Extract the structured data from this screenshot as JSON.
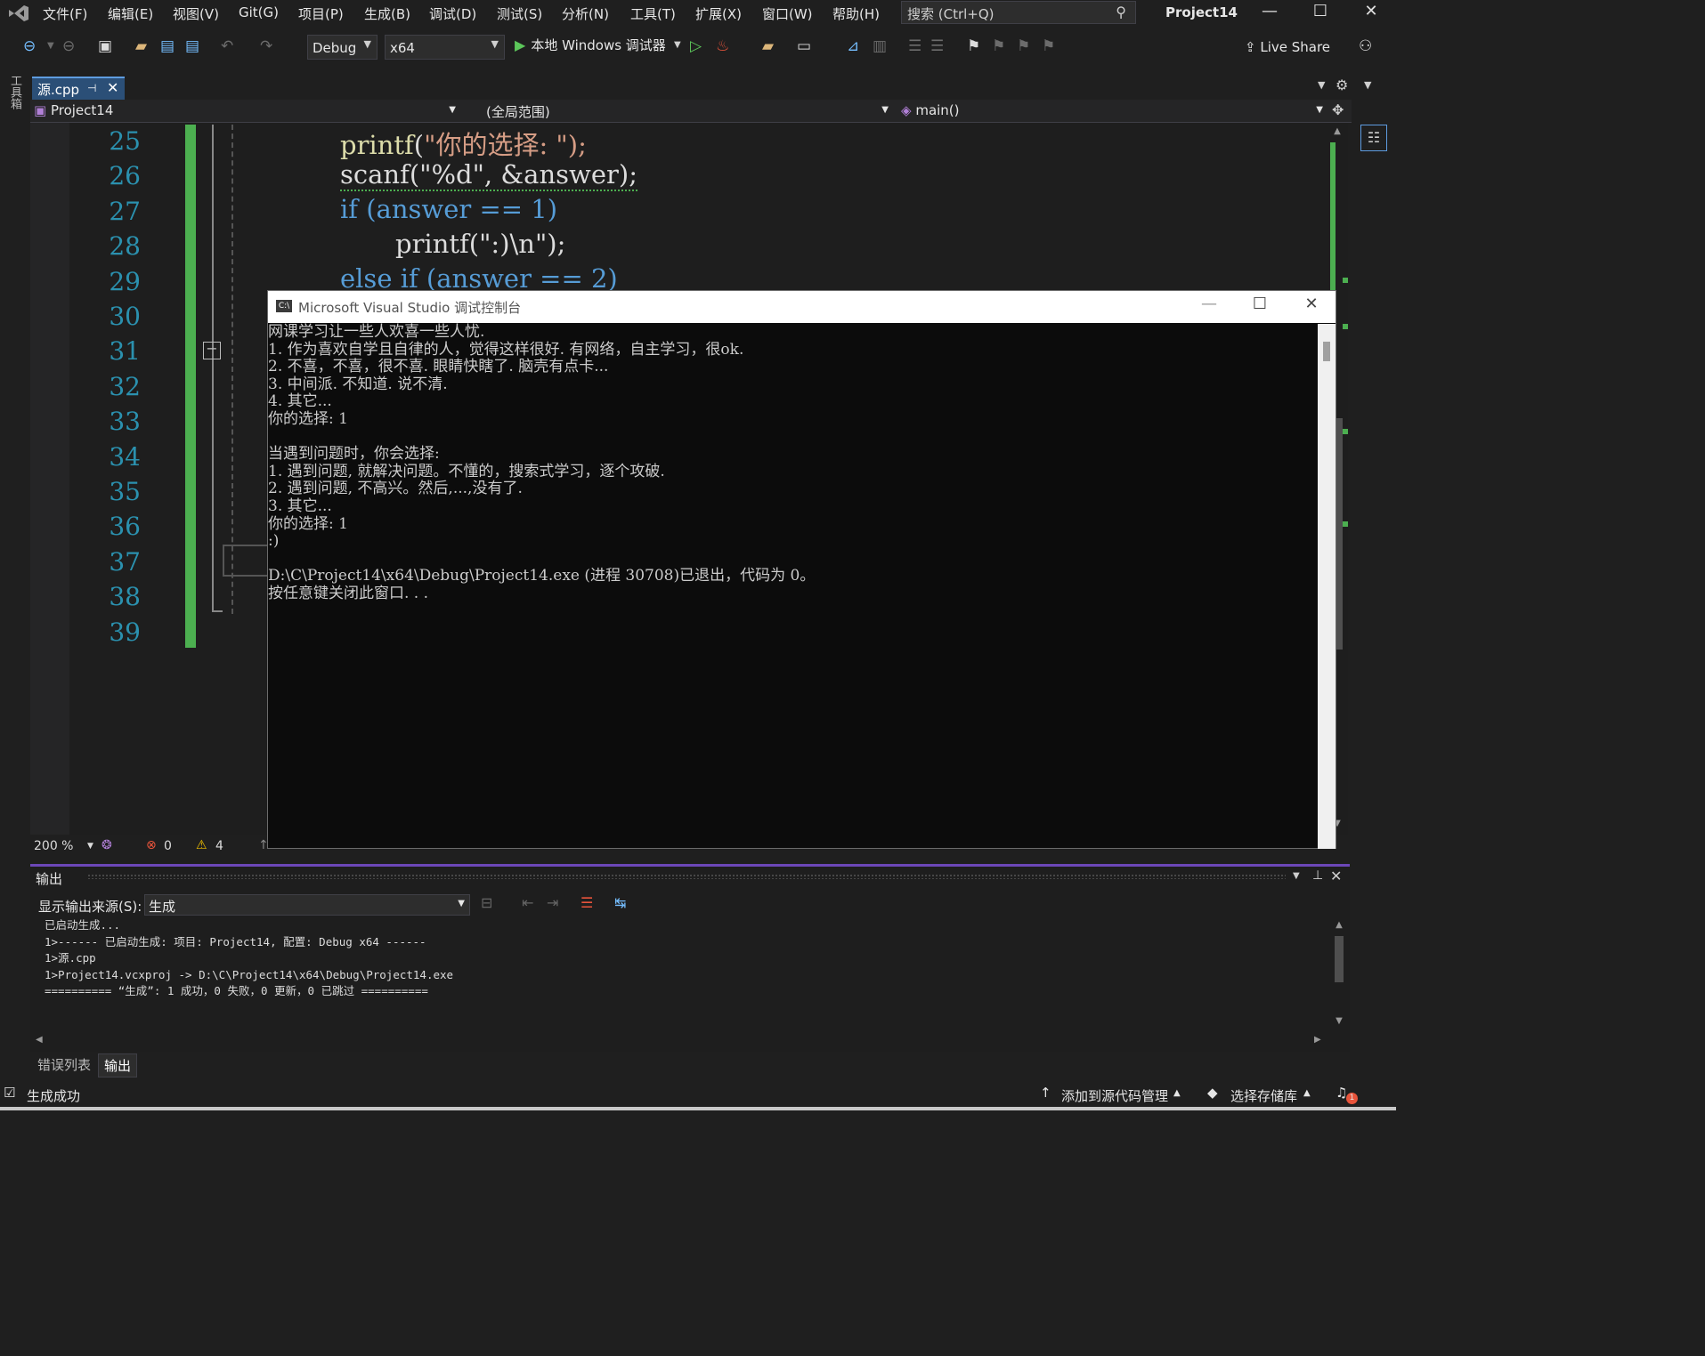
{
  "menu": {
    "items": [
      "文件(F)",
      "编辑(E)",
      "视图(V)",
      "Git(G)",
      "项目(P)",
      "生成(B)",
      "调试(D)",
      "测试(S)",
      "分析(N)",
      "工具(T)",
      "扩展(X)",
      "窗口(W)",
      "帮助(H)"
    ],
    "search_placeholder": "搜索 (Ctrl+Q)",
    "project_title": "Project14"
  },
  "toolbar": {
    "config": "Debug",
    "platform": "x64",
    "run_label": "本地 Windows 调试器",
    "live_share": "Live Share"
  },
  "sidebar": {
    "toolbox_label": "工具箱"
  },
  "tabs": {
    "active": "源.cpp"
  },
  "navbar": {
    "project": "Project14",
    "scope": "(全局范围)",
    "member": "main()"
  },
  "editor": {
    "line_numbers": [
      "25",
      "26",
      "27",
      "28",
      "29",
      "30",
      "31",
      "32",
      "33",
      "34",
      "35",
      "36",
      "37",
      "38",
      "39"
    ],
    "visible_code": [
      "printf(\"你的选择: \");",
      "scanf(\"%d\", &answer);",
      "if (answer == 1)",
      "printf(\":)\\n\");",
      "else if (answer == 2)"
    ],
    "zoom": "200 %",
    "errors": "0",
    "warnings": "4"
  },
  "console": {
    "title": "Microsoft Visual Studio 调试控制台",
    "lines": [
      "网课学习让一些人欢喜一些人忧.",
      "1. 作为喜欢自学且自律的人，觉得这样很好. 有网络，自主学习，很ok.",
      "2. 不喜，不喜，很不喜. 眼睛快瞎了. 脑壳有点卡...",
      "3. 中间派. 不知道. 说不清.",
      "4. 其它...",
      "你的选择: 1",
      "",
      "当遇到问题时，你会选择:",
      "1. 遇到问题, 就解决问题。不懂的，搜索式学习，逐个攻破.",
      "2. 遇到问题, 不高兴。然后,...,没有了.",
      "3. 其它...",
      "你的选择: 1",
      ":)",
      "",
      "D:\\C\\Project14\\x64\\Debug\\Project14.exe (进程 30708)已退出，代码为 0。",
      "按任意键关闭此窗口. . ."
    ]
  },
  "output": {
    "title": "输出",
    "source_label": "显示输出来源(S):",
    "source_value": "生成",
    "lines": [
      "已启动生成...",
      "1>------ 已启动生成: 项目: Project14, 配置: Debug x64 ------",
      "1>源.cpp",
      "1>Project14.vcxproj -> D:\\C\\Project14\\x64\\Debug\\Project14.exe",
      "========== “生成”: 1 成功，0 失败，0 更新，0 已跳过 =========="
    ]
  },
  "bottom_tabs": [
    "错误列表",
    "输出"
  ],
  "status": {
    "left": "生成成功",
    "source_control": "添加到源代码管理",
    "repo": "选择存储库",
    "notifications": "1"
  }
}
